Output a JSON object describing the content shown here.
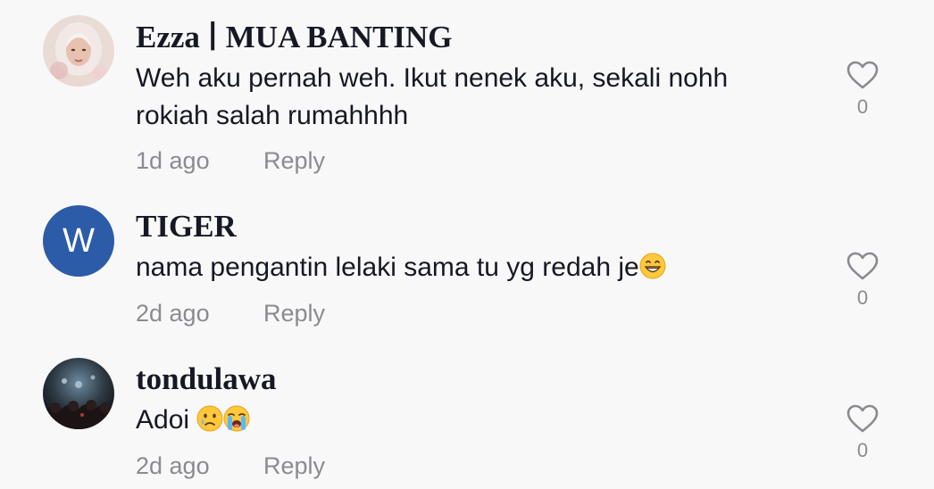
{
  "comments": [
    {
      "username": "Ezza ∣ MUA  BANTING",
      "text": "Weh aku pernah weh. Ikut nenek aku, sekali nohh rokiah salah rumahhhh",
      "time": "1d ago",
      "reply_label": "Reply",
      "likes": "0",
      "avatar_type": "photo-woman-hijab"
    },
    {
      "username": "TIGER",
      "text": "nama pengantin lelaki sama tu yg redah je",
      "emoji": "grinning-face-emoji",
      "time": "2d ago",
      "reply_label": "Reply",
      "likes": "0",
      "avatar_letter": "W",
      "avatar_color": "#2c5ba8"
    },
    {
      "username": "tondulawa",
      "text": "Adoi ",
      "emoji": [
        "crying-face-emoji",
        "loudly-crying-face-emoji"
      ],
      "time": "2d ago",
      "reply_label": "Reply",
      "likes": "0",
      "avatar_type": "photo-concert-crowd"
    }
  ],
  "icons": {
    "like": "heart-outline-icon"
  },
  "colors": {
    "background": "#f8f8f8",
    "primary_text": "#161823",
    "secondary_text": "#8a8b91"
  }
}
